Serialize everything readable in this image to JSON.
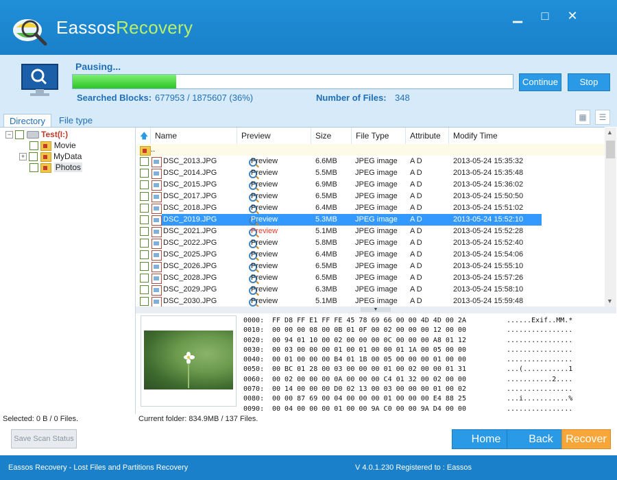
{
  "app": {
    "title_part1": "Eassos",
    "title_part2": "Recovery",
    "minimize": "▁",
    "maximize": "□",
    "close": "✕"
  },
  "scan": {
    "status": "Pausing...",
    "progress_percent": 36,
    "searched_blocks_label": "Searched Blocks:",
    "searched_blocks_value": "677953 / 1875607 (36%)",
    "num_files_label": "Number of Files:",
    "num_files_value": "348",
    "continue_label": "Continue",
    "stop_label": "Stop"
  },
  "tabs": {
    "directory": "Directory",
    "file_type": "File type"
  },
  "tree": {
    "root": "Test(I:)",
    "items": [
      "Movie",
      "MyData",
      "Photos"
    ],
    "root_expander": "−",
    "mydata_expander": "+"
  },
  "list": {
    "columns": [
      "Name",
      "Preview",
      "Size",
      "File Type",
      "Attribute",
      "Modify Time"
    ],
    "parent": "..",
    "rows": [
      {
        "name": "DSC_2013.JPG",
        "preview": "Preview",
        "size": "6.6MB",
        "type": "JPEG image",
        "attr": "A D",
        "time": "2013-05-24 15:35:32"
      },
      {
        "name": "DSC_2014.JPG",
        "preview": "Preview",
        "size": "5.5MB",
        "type": "JPEG image",
        "attr": "A D",
        "time": "2013-05-24 15:35:48"
      },
      {
        "name": "DSC_2015.JPG",
        "preview": "Preview",
        "size": "6.9MB",
        "type": "JPEG image",
        "attr": "A D",
        "time": "2013-05-24 15:36:02"
      },
      {
        "name": "DSC_2017.JPG",
        "preview": "Preview",
        "size": "6.5MB",
        "type": "JPEG image",
        "attr": "A D",
        "time": "2013-05-24 15:50:50"
      },
      {
        "name": "DSC_2018.JPG",
        "preview": "Preview",
        "size": "6.4MB",
        "type": "JPEG image",
        "attr": "A D",
        "time": "2013-05-24 15:51:02"
      },
      {
        "name": "DSC_2019.JPG",
        "preview": "Preview",
        "size": "5.3MB",
        "type": "JPEG image",
        "attr": "A D",
        "time": "2013-05-24 15:52:10"
      },
      {
        "name": "DSC_2021.JPG",
        "preview": "Preview",
        "size": "5.1MB",
        "type": "JPEG image",
        "attr": "A D",
        "time": "2013-05-24 15:52:28"
      },
      {
        "name": "DSC_2022.JPG",
        "preview": "Preview",
        "size": "5.8MB",
        "type": "JPEG image",
        "attr": "A D",
        "time": "2013-05-24 15:52:40"
      },
      {
        "name": "DSC_2025.JPG",
        "preview": "Preview",
        "size": "6.4MB",
        "type": "JPEG image",
        "attr": "A D",
        "time": "2013-05-24 15:54:06"
      },
      {
        "name": "DSC_2026.JPG",
        "preview": "Preview",
        "size": "6.5MB",
        "type": "JPEG image",
        "attr": "A D",
        "time": "2013-05-24 15:55:10"
      },
      {
        "name": "DSC_2028.JPG",
        "preview": "Preview",
        "size": "6.5MB",
        "type": "JPEG image",
        "attr": "A D",
        "time": "2013-05-24 15:57:26"
      },
      {
        "name": "DSC_2029.JPG",
        "preview": "Preview",
        "size": "6.3MB",
        "type": "JPEG image",
        "attr": "A D",
        "time": "2013-05-24 15:58:10"
      },
      {
        "name": "DSC_2030.JPG",
        "preview": "Preview",
        "size": "5.1MB",
        "type": "JPEG image",
        "attr": "A D",
        "time": "2013-05-24 15:59:48"
      }
    ],
    "selected_index": 5,
    "red_preview_index": 6
  },
  "hex": [
    {
      "addr": "0000:",
      "bytes": "FF D8 FF E1 FF FE 45 78 69 66 00 00 4D 4D 00 2A",
      "ascii": "......Exif..MM.*"
    },
    {
      "addr": "0010:",
      "bytes": "00 00 00 08 00 0B 01 0F 00 02 00 00 00 12 00 00",
      "ascii": "................"
    },
    {
      "addr": "0020:",
      "bytes": "00 94 01 10 00 02 00 00 00 0C 00 00 00 A8 01 12",
      "ascii": "................"
    },
    {
      "addr": "0030:",
      "bytes": "00 03 00 00 00 01 00 01 00 00 01 1A 00 05 00 00",
      "ascii": "................"
    },
    {
      "addr": "0040:",
      "bytes": "00 01 00 00 00 B4 01 1B 00 05 00 00 00 01 00 00",
      "ascii": "................"
    },
    {
      "addr": "0050:",
      "bytes": "00 BC 01 28 00 03 00 00 00 01 00 02 00 00 01 31",
      "ascii": "...(...........1"
    },
    {
      "addr": "0060:",
      "bytes": "00 02 00 00 00 0A 00 00 00 C4 01 32 00 02 00 00",
      "ascii": "...........2...."
    },
    {
      "addr": "0070:",
      "bytes": "00 14 00 00 00 D0 02 13 00 03 00 00 00 01 00 02",
      "ascii": "................"
    },
    {
      "addr": "0080:",
      "bytes": "00 00 87 69 00 04 00 00 00 01 00 00 00 E4 88 25",
      "ascii": "...i...........%"
    },
    {
      "addr": "0090:",
      "bytes": "00 04 00 00 00 01 00 00 9A C0 00 00 9A D4 00 00",
      "ascii": "................"
    }
  ],
  "bottom": {
    "selected": "Selected: 0 B / 0 Files.",
    "current_folder": "Current folder: 834.9MB / 137 Files.",
    "save_scan": "Save Scan Status",
    "home": "Home",
    "back": "Back",
    "recover": "Recover"
  },
  "statusbar": {
    "left": "Eassos Recovery - Lost Files and Partitions Recovery",
    "version": "V 4.0.1.230  Registered to : Eassos"
  }
}
